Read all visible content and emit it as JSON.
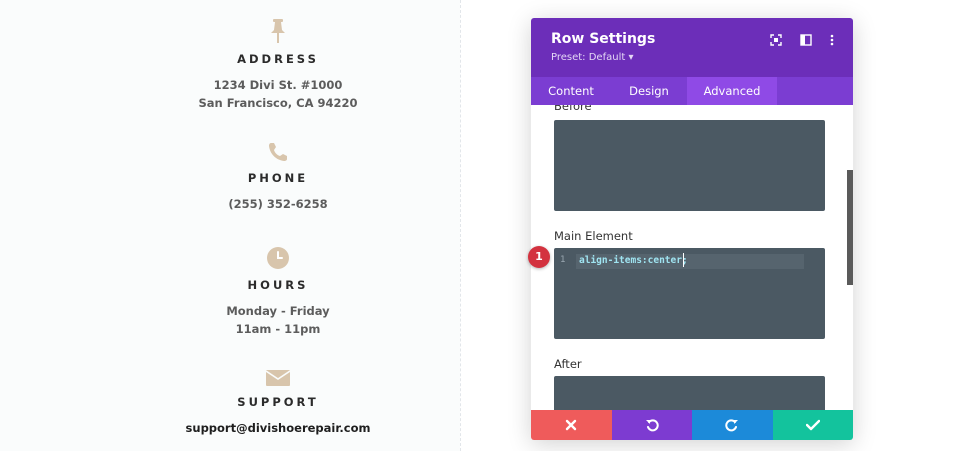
{
  "contact": {
    "address": {
      "icon": "pushpin-icon",
      "heading": "ADDRESS",
      "lines": [
        "1234 Divi St. #1000",
        "San Francisco, CA 94220"
      ]
    },
    "phone": {
      "icon": "phone-icon",
      "heading": "PHONE",
      "lines": [
        "(255) 352-6258"
      ]
    },
    "hours": {
      "icon": "clock-icon",
      "heading": "HOURS",
      "lines": [
        "Monday - Friday",
        "11am - 11pm"
      ]
    },
    "support": {
      "icon": "envelope-icon",
      "heading": "SUPPORT",
      "lines": [
        "support@divishoerepair.com"
      ]
    },
    "icon_color": "#d8c5ac"
  },
  "modal": {
    "title": "Row Settings",
    "preset": "Preset: Default",
    "preset_caret": "▾",
    "header_icons": [
      "fullscreen-icon",
      "split-view-icon",
      "more-options-icon"
    ],
    "tabs": [
      {
        "label": "Content",
        "active": false
      },
      {
        "label": "Design",
        "active": false
      },
      {
        "label": "Advanced",
        "active": true
      }
    ],
    "sections": {
      "before": {
        "label": "Before",
        "value": ""
      },
      "main": {
        "label": "Main Element",
        "line_number": "1",
        "code": "align-items:center;"
      },
      "after": {
        "label": "After",
        "value": ""
      }
    },
    "badge": "1",
    "footer_buttons": [
      {
        "action": "discard",
        "icon": "close-icon",
        "color": "#ef5b5b"
      },
      {
        "action": "undo",
        "icon": "undo-icon",
        "color": "#7d3bd1"
      },
      {
        "action": "redo",
        "icon": "redo-icon",
        "color": "#1c8ad9"
      },
      {
        "action": "save",
        "icon": "checkmark-icon",
        "color": "#13c39d"
      }
    ],
    "colors": {
      "header": "#6c2eb9",
      "tabs": "#7b3dd2",
      "active_tab": "#8f4ae6",
      "editor": "#4b5963",
      "badge": "#d3323f"
    }
  }
}
